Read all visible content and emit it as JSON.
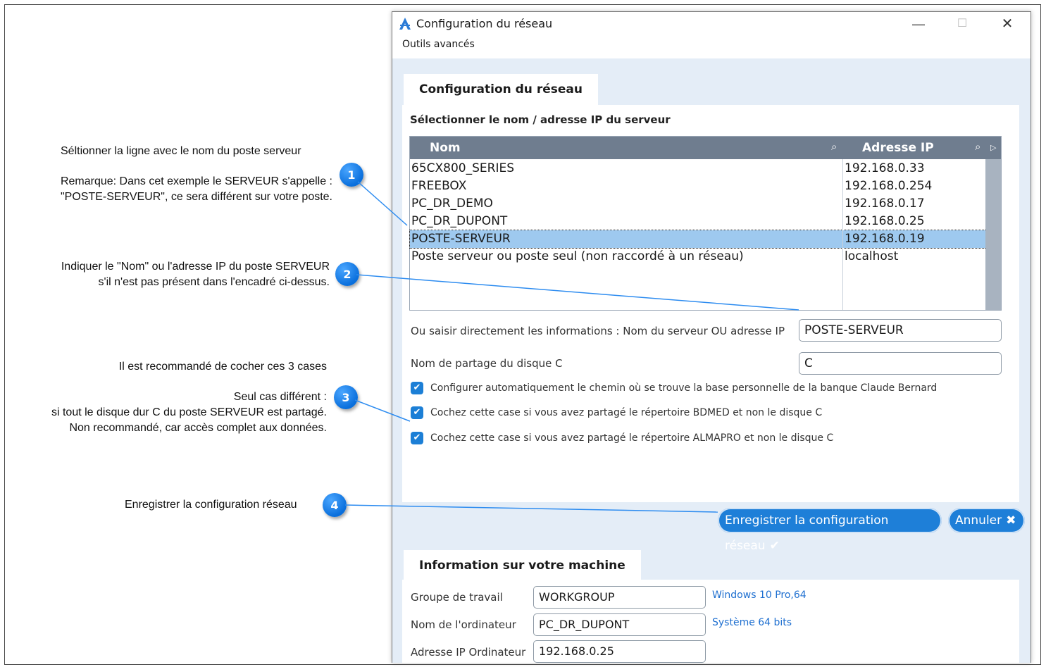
{
  "annotations": {
    "a1_line1": "Séltionner la ligne avec le nom du poste serveur",
    "a1_line2": "Remarque: Dans cet exemple le SERVEUR s'appelle :",
    "a1_line3": "\"POSTE-SERVEUR\", ce sera différent sur votre poste.",
    "a2_line1": "Indiquer le \"Nom\" ou l'adresse IP du poste SERVEUR",
    "a2_line2": "s'il n'est pas présent dans l'encadré ci-dessus.",
    "a3_line1": "Il est recommandé de cocher ces 3 cases",
    "a3_line2": "Seul cas différent :",
    "a3_line3": "si tout le disque dur C du poste SERVEUR est partagé.",
    "a3_line4": "Non recommandé, car accès complet aux données.",
    "a4_line1": "Enregistrer la configuration réseau"
  },
  "badges": [
    "1",
    "2",
    "3",
    "4"
  ],
  "window": {
    "title": "Configuration du réseau",
    "menu": "Outils avancés",
    "minimize": "—",
    "maximize": "☐",
    "close": "✕"
  },
  "network_tab": {
    "tab_label": "Configuration du réseau",
    "select_label": "Sélectionner le nom / adresse IP du serveur",
    "columns": {
      "name": "Nom",
      "ip": "Adresse IP"
    },
    "rows": [
      {
        "name": "65CX800_SERIES",
        "ip": "192.168.0.33"
      },
      {
        "name": "FREEBOX",
        "ip": "192.168.0.254"
      },
      {
        "name": "PC_DR_DEMO",
        "ip": "192.168.0.17"
      },
      {
        "name": "PC_DR_DUPONT",
        "ip": "192.168.0.25"
      },
      {
        "name": "POSTE-SERVEUR",
        "ip": "192.168.0.19"
      },
      {
        "name": "Poste serveur ou poste seul (non raccordé à un réseau)",
        "ip": "localhost"
      }
    ],
    "direct_label": "Ou saisir directement les informations : Nom du serveur OU adresse IP",
    "direct_value": "POSTE-SERVEUR",
    "share_label": "Nom de partage du disque C",
    "share_value": "C",
    "checkboxes": [
      "Configurer automatiquement le chemin où se trouve la base personnelle de la banque Claude Bernard",
      "Cochez cette case si vous avez partagé le répertoire BDMED et non le disque C",
      "Cochez cette case si vous avez partagé le répertoire ALMAPRO et non le disque C"
    ],
    "save_button": "Enregistrer la configuration réseau",
    "cancel_button": "Annuler"
  },
  "machine_tab": {
    "tab_label": "Information sur votre machine",
    "workgroup_label": "Groupe de travail",
    "workgroup_value": "WORKGROUP",
    "computer_label": "Nom de l'ordinateur",
    "computer_value": "PC_DR_DUPONT",
    "ip_label": "Adresse IP Ordinateur",
    "ip_value": "192.168.0.25",
    "os_info": "Windows 10 Pro,64",
    "arch_info": "Système 64 bits"
  },
  "colors": {
    "accent": "#1e7fd8",
    "panel_bg": "#e4edf7",
    "header": "#6f7d8f",
    "selected_row": "#9ec9ef"
  }
}
